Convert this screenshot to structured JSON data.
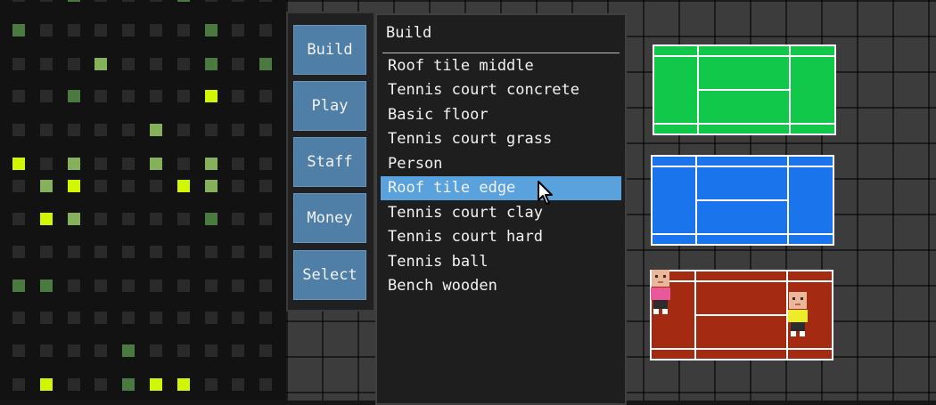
{
  "indicator_grid": {
    "colors": {
      "off": "#2a2a2a",
      "dim": "#4a7a40",
      "mid": "#86b05a",
      "bright": "#d2f500"
    },
    "rows": [
      "--d---d---b",
      "d------d---",
      "---m---d-dd",
      "--d----b---",
      "-----m-----",
      "b-m--m-m--b",
      "-mb---bm---",
      "-bm----d---",
      "-----------",
      "dd---------",
      "-----------",
      "----d------",
      "-b--dbb----"
    ]
  },
  "menu": {
    "buttons": [
      {
        "label": "Build"
      },
      {
        "label": "Play"
      },
      {
        "label": "Staff"
      },
      {
        "label": "Money"
      },
      {
        "label": "Select"
      }
    ]
  },
  "build_list": {
    "header": "Build",
    "items": [
      "Roof tile middle",
      "Tennis court concrete",
      "Basic floor",
      "Tennis court grass",
      "Person",
      "Roof tile edge",
      "Tennis court clay",
      "Tennis court hard",
      "Tennis ball",
      "Bench wooden"
    ],
    "selected_index": 5
  },
  "courts": [
    {
      "surface": "grass",
      "color": "#11c84a"
    },
    {
      "surface": "hard",
      "color": "#1a74ec"
    },
    {
      "surface": "clay",
      "color": "#a42b12"
    }
  ],
  "players": [
    {
      "shirt_color": "#e8589a"
    },
    {
      "shirt_color": "#ecec2a"
    }
  ],
  "icons": {
    "cursor": "arrow-cursor-icon"
  }
}
